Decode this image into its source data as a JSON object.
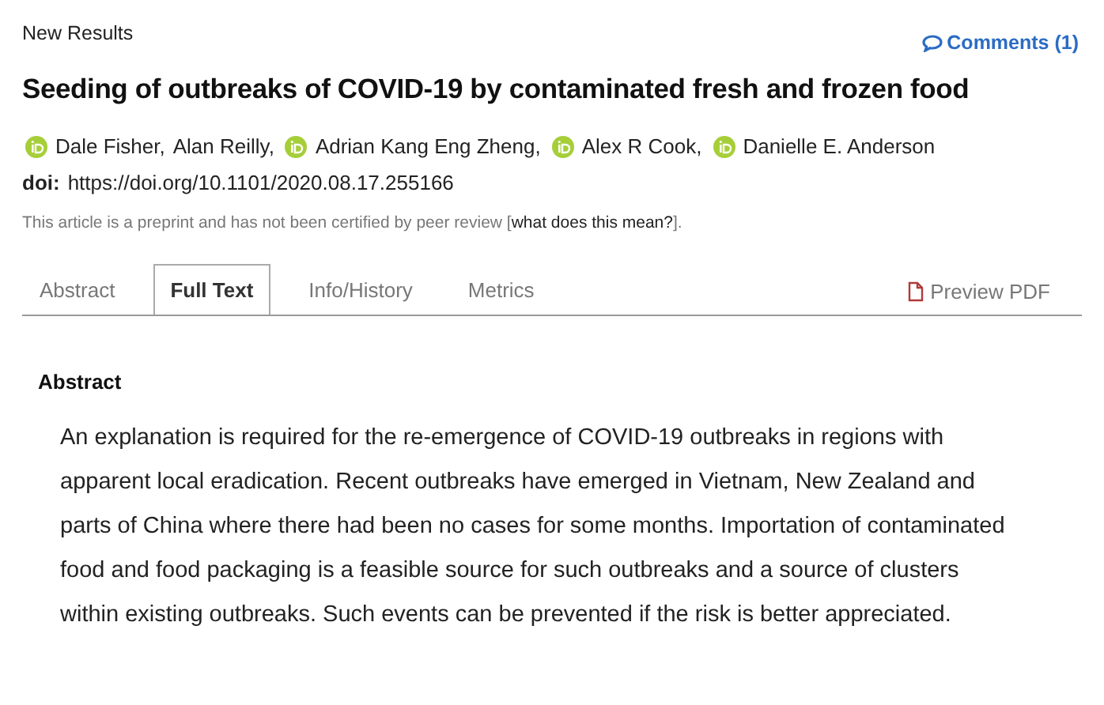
{
  "section_label": "New Results",
  "comments_link": "Comments (1)",
  "title": "Seeding of outbreaks of COVID-19 by contaminated fresh and frozen food",
  "authors": [
    {
      "name": "Dale Fisher,",
      "orcid": true
    },
    {
      "name": "Alan Reilly,",
      "orcid": false
    },
    {
      "name": "Adrian Kang Eng Zheng,",
      "orcid": true
    },
    {
      "name": "Alex R Cook,",
      "orcid": true
    },
    {
      "name": "Danielle E. Anderson",
      "orcid": true
    }
  ],
  "doi": {
    "label": "doi:",
    "value": "https://doi.org/10.1101/2020.08.17.255166"
  },
  "notice": {
    "text": "This article is a preprint and has not been certified by peer review [",
    "link": "what does this mean?",
    "end": "]."
  },
  "tabs": [
    {
      "label": "Abstract",
      "selected": false
    },
    {
      "label": "Full Text",
      "selected": true
    },
    {
      "label": "Info/History",
      "selected": false
    },
    {
      "label": "Metrics",
      "selected": false
    }
  ],
  "pdf_link": "Preview PDF",
  "abstract": {
    "heading": "Abstract",
    "text": "An explanation is required for the re-emergence of COVID-19 outbreaks in regions with apparent local eradication. Recent outbreaks have emerged in Vietnam, New Zealand and parts of China where there had been no cases for some months. Importation of contaminated food and food packaging is a feasible source for such outbreaks and a source of clusters within existing outbreaks. Such events can be prevented if the risk is better appreciated."
  }
}
